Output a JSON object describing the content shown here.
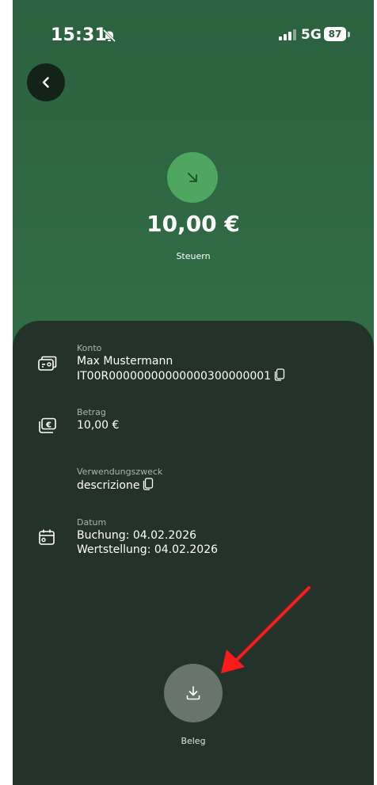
{
  "status": {
    "time": "15:31",
    "network": "5G",
    "battery": "87"
  },
  "header": {
    "amount": "10,00 €",
    "category": "Steuern"
  },
  "details": {
    "konto": {
      "label": "Konto",
      "name": "Max Mustermann",
      "iban": "IT00R00000000000000300000001"
    },
    "betrag": {
      "label": "Betrag",
      "value": "10,00 €"
    },
    "verwendungszweck": {
      "label": "Verwendungszweck",
      "value": "descrizione"
    },
    "datum": {
      "label": "Datum",
      "buchung": "Buchung: 04.02.2026",
      "wertstellung": "Wertstellung: 04.02.2026"
    }
  },
  "actions": {
    "receipt_label": "Beleg"
  },
  "colors": {
    "header_green": "#2b6140",
    "icon_green": "#4ea660",
    "sheet": "#233329",
    "annotation_arrow": "#ff1a1a"
  },
  "icons": [
    "bell-mute-icon",
    "signal-icon",
    "battery-icon",
    "back-chevron-icon",
    "incoming-arrow-icon",
    "account-card-icon",
    "copy-icon",
    "euro-bill-icon",
    "calendar-icon",
    "download-icon"
  ]
}
